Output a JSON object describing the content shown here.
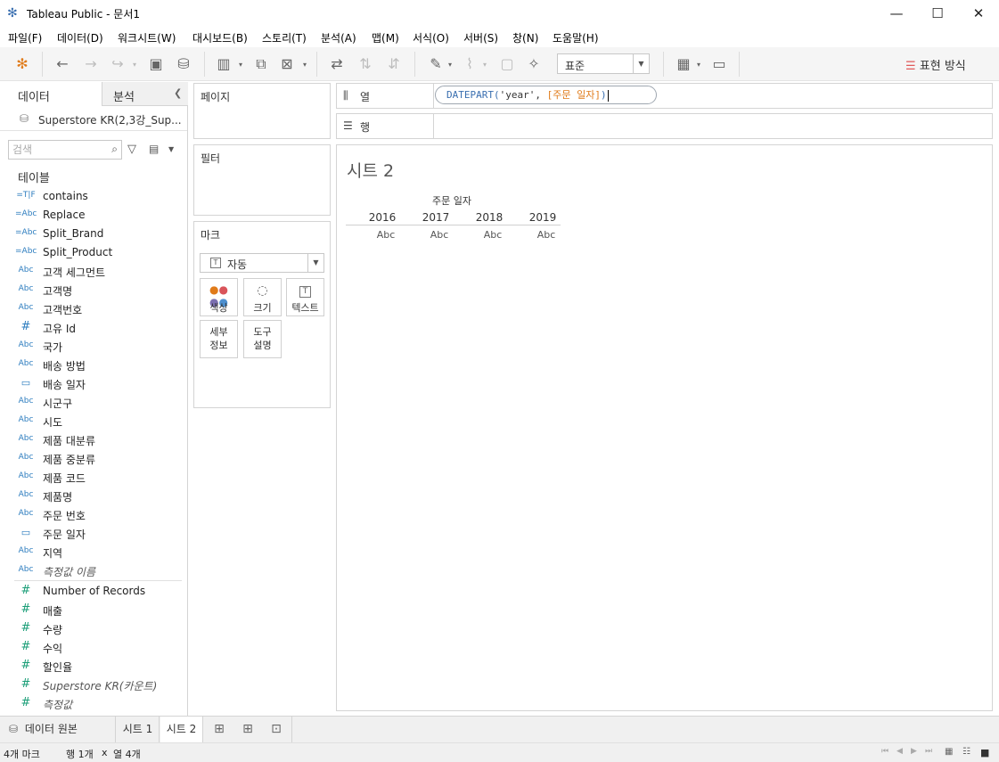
{
  "window": {
    "title": "Tableau Public - 문서1"
  },
  "menu": [
    "파일(F)",
    "데이터(D)",
    "워크시트(W)",
    "대시보드(B)",
    "스토리(T)",
    "분석(A)",
    "맵(M)",
    "서식(O)",
    "서버(S)",
    "창(N)",
    "도움말(H)"
  ],
  "toolbar": {
    "format_select": "표준",
    "show_me": "표현 방식"
  },
  "left": {
    "tab_data": "데이터",
    "tab_analysis": "분석",
    "datasource": "Superstore KR(2,3강_Sup...",
    "search_placeholder": "검색",
    "tables_heading": "테이블",
    "dimensions": [
      {
        "icon": "=T|F",
        "label": "contains"
      },
      {
        "icon": "=Abc",
        "label": "Replace"
      },
      {
        "icon": "=Abc",
        "label": "Split_Brand"
      },
      {
        "icon": "=Abc",
        "label": "Split_Product"
      },
      {
        "icon": "Abc",
        "label": "고객 세그먼트"
      },
      {
        "icon": "Abc",
        "label": "고객명"
      },
      {
        "icon": "Abc",
        "label": "고객번호"
      },
      {
        "icon": "#",
        "label": "고유 Id"
      },
      {
        "icon": "Abc",
        "label": "국가"
      },
      {
        "icon": "Abc",
        "label": "배송 방법"
      },
      {
        "icon": "date",
        "label": "배송 일자"
      },
      {
        "icon": "Abc",
        "label": "시군구"
      },
      {
        "icon": "Abc",
        "label": "시도"
      },
      {
        "icon": "Abc",
        "label": "제품 대분류"
      },
      {
        "icon": "Abc",
        "label": "제품 중분류"
      },
      {
        "icon": "Abc",
        "label": "제품 코드"
      },
      {
        "icon": "Abc",
        "label": "제품명"
      },
      {
        "icon": "Abc",
        "label": "주문 번호"
      },
      {
        "icon": "date",
        "label": "주문 일자"
      },
      {
        "icon": "Abc",
        "label": "지역"
      },
      {
        "icon": "Abc",
        "label": "측정값 이름"
      }
    ],
    "measures": [
      {
        "label": "Number of Records"
      },
      {
        "label": "매출"
      },
      {
        "label": "수량"
      },
      {
        "label": "수익"
      },
      {
        "label": "할인율"
      },
      {
        "label": "Superstore KR(카운트)"
      },
      {
        "label": "측정값"
      }
    ]
  },
  "cards": {
    "pages": "페이지",
    "filters": "필터",
    "marks": "마크",
    "marks_type": "자동",
    "mark_buttons": {
      "color": "색상",
      "size": "크기",
      "text": "텍스트",
      "detail": "세부\n정보",
      "tooltip": "도구\n설명"
    }
  },
  "shelves": {
    "columns_label": "열",
    "rows_label": "행",
    "col_pill": {
      "fn": "DATEPART(",
      "arg": "'year', ",
      "field": "[주문 일자]",
      "close": ")"
    }
  },
  "viz": {
    "sheet_title": "시트 2",
    "header": "주문 일자",
    "years": [
      "2016",
      "2017",
      "2018",
      "2019"
    ],
    "cell": "Abc"
  },
  "bottom": {
    "datasource_tab": "데이터 원본",
    "sheets": [
      "시트 1",
      "시트 2"
    ]
  },
  "status": {
    "marks": "4개 마크",
    "rows": "행 1개",
    "x": "x",
    "cols": "열 4개"
  }
}
